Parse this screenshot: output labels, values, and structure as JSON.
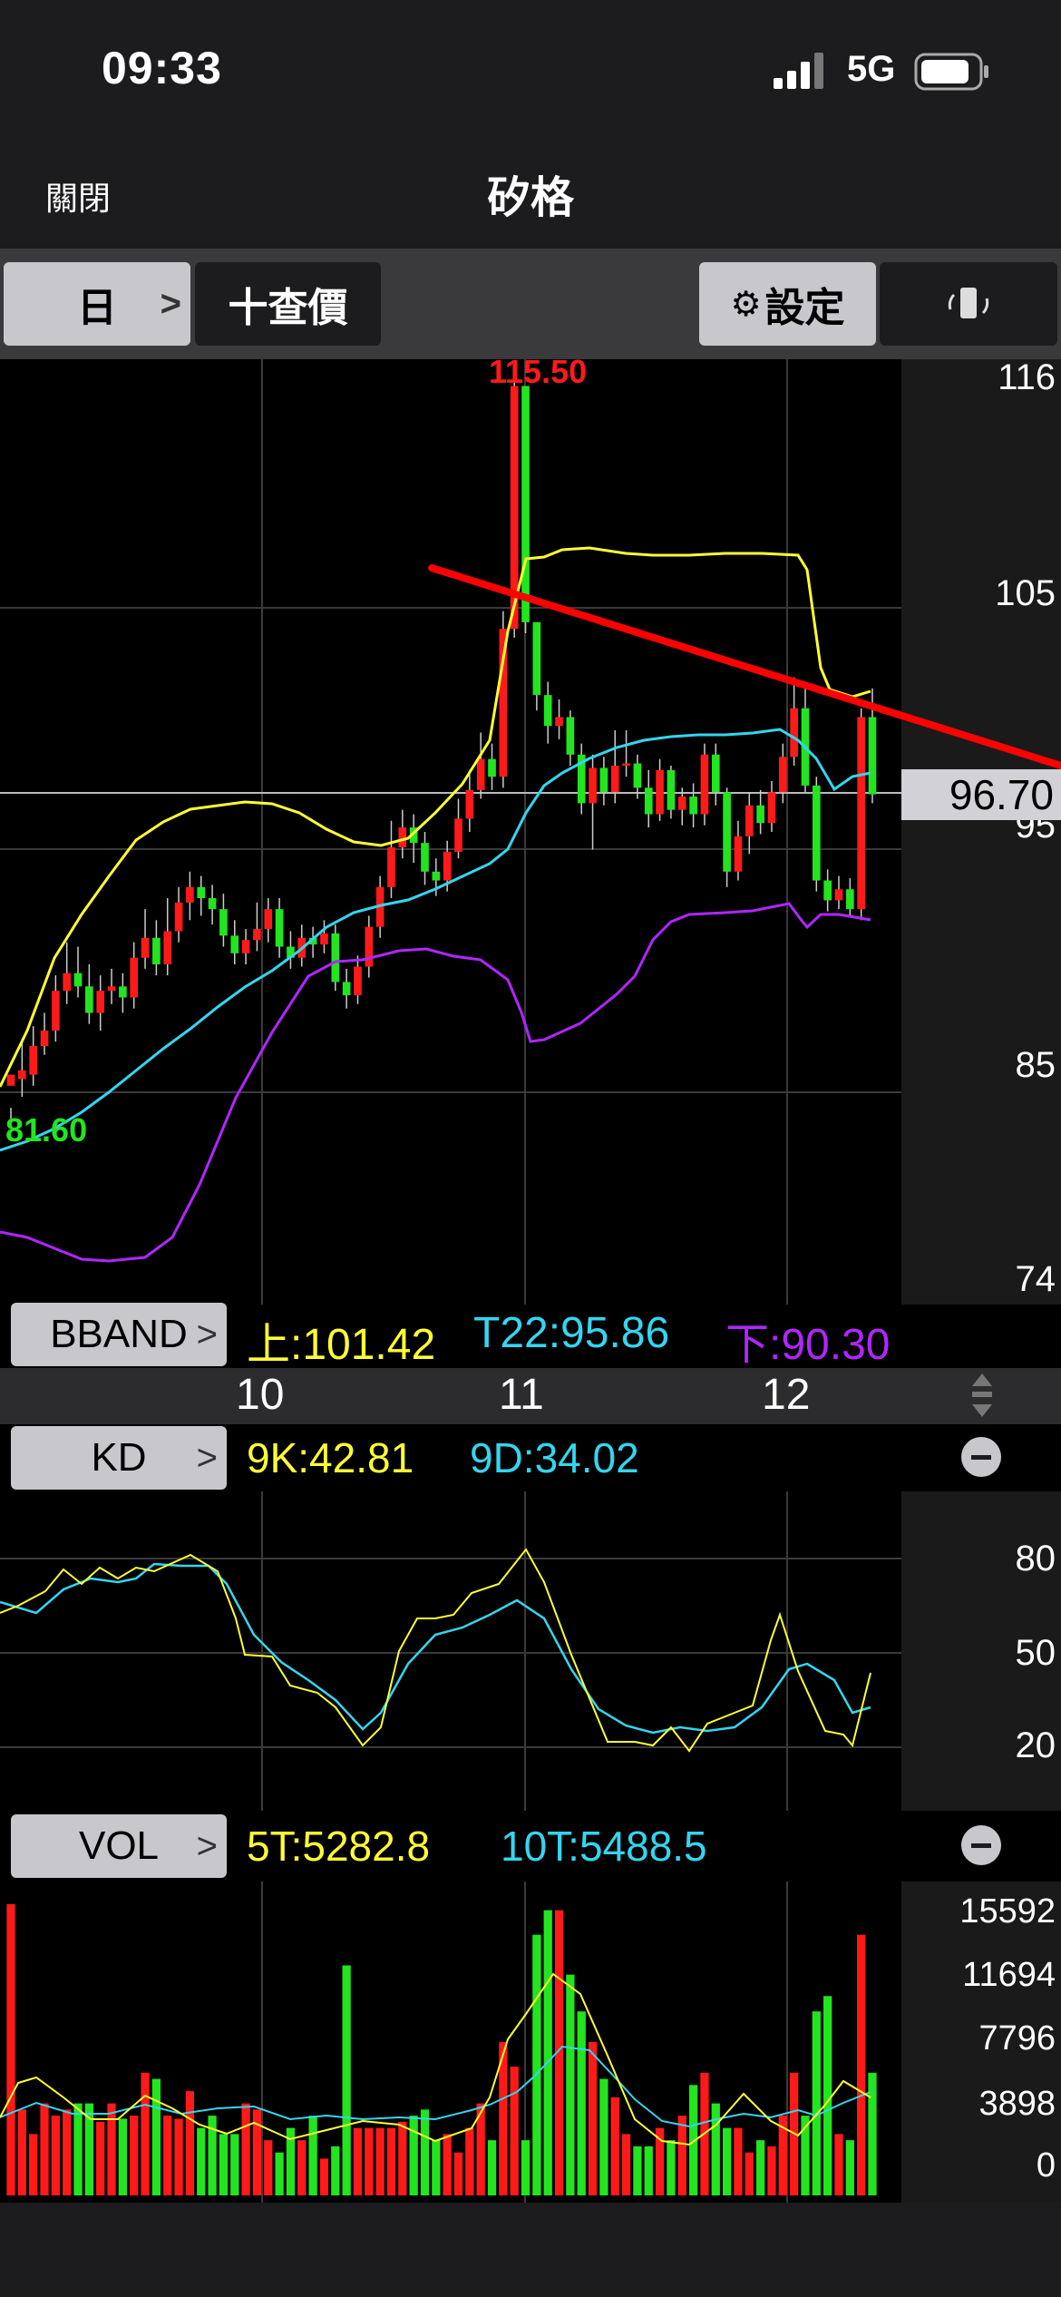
{
  "status_bar": {
    "time": "09:33",
    "network": "5G"
  },
  "nav": {
    "close_label": "關閉",
    "title": "矽格"
  },
  "toolbar": {
    "period_label": "日",
    "query_label": "十查價",
    "settings_label": "設定",
    "rotate_icon": "rotate-icon"
  },
  "price_chart": {
    "y_ticks": [
      "116",
      "105",
      "95",
      "85",
      "74"
    ],
    "last_price": "96.70",
    "high_label": "115.50",
    "low_label": "81.60",
    "indicator_button": "BBAND",
    "legend": {
      "upper": "上:101.42",
      "mid": "T22:95.86",
      "lower": "下:90.30"
    }
  },
  "x_axis": {
    "labels": [
      "10",
      "11",
      "12"
    ]
  },
  "kd_panel": {
    "indicator_button": "KD",
    "legend": {
      "k": "9K:42.81",
      "d": "9D:34.02"
    },
    "y_ticks": [
      "80",
      "50",
      "20"
    ]
  },
  "vol_panel": {
    "indicator_button": "VOL",
    "legend": {
      "ma5": "5T:5282.8",
      "ma10": "10T:5488.5"
    },
    "y_ticks": [
      "15592",
      "11694",
      "7796",
      "3898",
      "0"
    ]
  },
  "colors": {
    "up": "#ff1a1a",
    "down": "#22e51f",
    "upper_band": "#ffff33",
    "mid_band": "#33d6f0",
    "lower_band": "#b026ff",
    "trendline": "#ff0000"
  },
  "chart_data": {
    "type": "candlestick",
    "x_labels": [
      "10",
      "11",
      "12"
    ],
    "ylim": [
      74,
      116
    ],
    "high": 115.5,
    "low": 81.6,
    "last": 96.7,
    "bband": {
      "upper": 101.42,
      "mid": 95.86,
      "lower": 90.3
    },
    "kd": {
      "k": 42.81,
      "d": 34.02,
      "ylim": [
        0,
        100
      ]
    },
    "volume": {
      "ma5": 5282.8,
      "ma10": 5488.5,
      "ylim": [
        0,
        15592
      ]
    },
    "candles": [
      [
        83.5,
        84.0,
        82.5,
        81.6
      ],
      [
        83.8,
        84.2,
        85.5,
        83.0
      ],
      [
        84.0,
        85.3,
        86.2,
        83.5
      ],
      [
        85.3,
        86.0,
        86.8,
        84.9
      ],
      [
        86.0,
        87.8,
        88.5,
        85.5
      ],
      [
        87.8,
        88.6,
        90.0,
        87.2
      ],
      [
        88.6,
        88.0,
        89.8,
        87.5
      ],
      [
        88.0,
        86.8,
        89.0,
        86.3
      ],
      [
        86.8,
        87.8,
        88.5,
        86.0
      ],
      [
        87.8,
        88.0,
        88.8,
        87.2
      ],
      [
        88.0,
        87.5,
        88.6,
        86.8
      ],
      [
        87.5,
        89.3,
        90.0,
        87.0
      ],
      [
        89.3,
        90.2,
        91.5,
        88.8
      ],
      [
        90.2,
        89.0,
        91.0,
        88.5
      ],
      [
        89.0,
        90.5,
        92.0,
        88.5
      ],
      [
        90.5,
        91.8,
        92.5,
        90.0
      ],
      [
        91.8,
        92.5,
        93.2,
        91.0
      ],
      [
        92.5,
        92.0,
        93.0,
        91.2
      ],
      [
        92.0,
        91.5,
        92.6,
        90.8
      ],
      [
        91.5,
        90.3,
        92.2,
        89.8
      ],
      [
        90.3,
        89.5,
        91.0,
        89.0
      ],
      [
        89.5,
        90.1,
        90.6,
        89.0
      ],
      [
        90.1,
        90.6,
        91.8,
        89.6
      ],
      [
        90.6,
        91.5,
        92.0,
        90.0
      ],
      [
        91.5,
        89.8,
        92.0,
        89.3
      ],
      [
        89.8,
        89.3,
        90.5,
        88.8
      ],
      [
        89.3,
        90.2,
        90.8,
        88.9
      ],
      [
        90.2,
        89.9,
        90.7,
        89.3
      ],
      [
        89.9,
        90.4,
        91.0,
        89.5
      ],
      [
        90.4,
        88.2,
        90.8,
        87.8
      ],
      [
        88.2,
        87.6,
        88.8,
        87.0
      ],
      [
        87.6,
        88.9,
        89.4,
        87.2
      ],
      [
        88.9,
        90.7,
        91.2,
        88.4
      ],
      [
        90.7,
        92.5,
        93.0,
        90.2
      ],
      [
        92.5,
        94.3,
        95.5,
        92.0
      ],
      [
        94.3,
        95.2,
        96.0,
        93.8
      ],
      [
        95.2,
        94.5,
        95.8,
        93.6
      ],
      [
        94.5,
        93.2,
        95.0,
        92.6
      ],
      [
        93.2,
        92.8,
        93.8,
        92.1
      ],
      [
        92.8,
        94.1,
        94.6,
        92.3
      ],
      [
        94.1,
        95.6,
        96.5,
        93.8
      ],
      [
        95.6,
        96.9,
        97.8,
        95.0
      ],
      [
        96.9,
        98.3,
        99.5,
        96.5
      ],
      [
        98.3,
        97.5,
        99.0,
        96.9
      ],
      [
        97.5,
        104.2,
        105.0,
        97.0
      ],
      [
        104.2,
        115.2,
        115.5,
        103.8
      ],
      [
        115.2,
        104.5,
        115.0,
        104.0
      ],
      [
        104.5,
        101.2,
        102.0,
        100.5
      ],
      [
        101.2,
        99.8,
        101.8,
        99.0
      ],
      [
        99.8,
        100.2,
        101.0,
        99.2
      ],
      [
        100.2,
        98.5,
        100.5,
        98.0
      ],
      [
        98.5,
        96.3,
        99.0,
        95.8
      ],
      [
        96.3,
        97.9,
        98.5,
        94.2
      ],
      [
        97.9,
        96.8,
        98.4,
        96.2
      ],
      [
        96.8,
        98.0,
        99.6,
        96.3
      ],
      [
        98.0,
        98.1,
        99.6,
        97.5
      ],
      [
        98.1,
        97.0,
        98.5,
        96.5
      ],
      [
        97.0,
        95.8,
        97.8,
        95.2
      ],
      [
        95.8,
        97.8,
        98.3,
        95.5
      ],
      [
        97.8,
        96.0,
        98.0,
        95.6
      ],
      [
        96.0,
        96.6,
        97.0,
        95.3
      ],
      [
        96.6,
        95.8,
        97.2,
        95.2
      ],
      [
        95.8,
        98.5,
        99.0,
        95.3
      ],
      [
        98.5,
        96.8,
        99.0,
        96.2
      ],
      [
        96.8,
        93.2,
        97.0,
        92.5
      ],
      [
        93.2,
        94.8,
        95.5,
        92.8
      ],
      [
        94.8,
        96.2,
        96.8,
        94.0
      ],
      [
        96.2,
        95.4,
        96.9,
        94.9
      ],
      [
        95.4,
        96.8,
        97.3,
        95.0
      ],
      [
        96.8,
        98.4,
        99.0,
        96.3
      ],
      [
        98.4,
        100.6,
        102.0,
        98.0
      ],
      [
        100.6,
        97.1,
        101.5,
        96.8
      ],
      [
        97.1,
        92.8,
        97.5,
        92.3
      ],
      [
        92.8,
        91.9,
        93.3,
        91.4
      ],
      [
        91.9,
        92.4,
        93.0,
        91.5
      ],
      [
        92.4,
        91.5,
        92.9,
        91.2
      ],
      [
        91.5,
        100.2,
        100.6,
        91.0
      ],
      [
        100.2,
        96.7,
        101.5,
        96.3
      ]
    ]
  }
}
